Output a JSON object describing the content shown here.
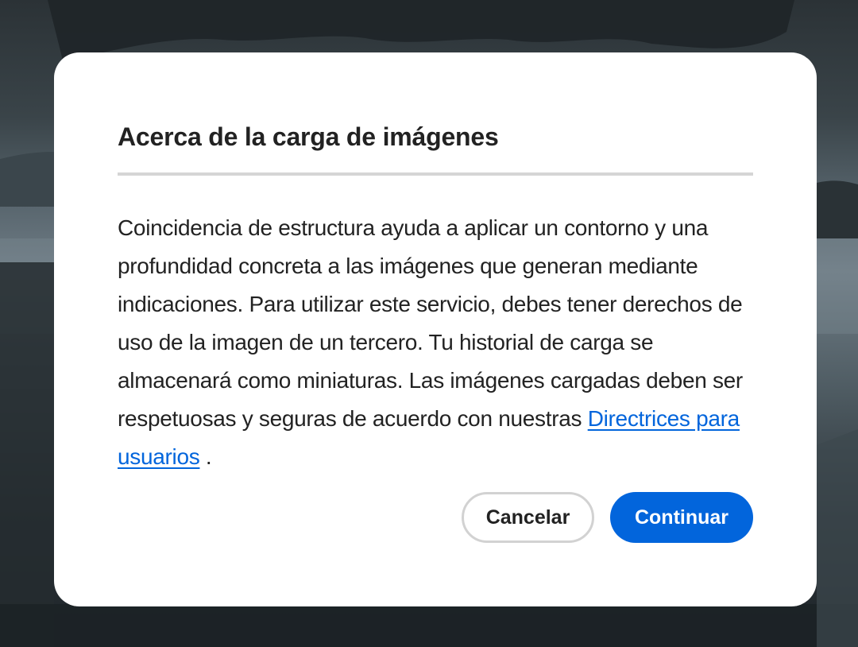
{
  "dialog": {
    "title": "Acerca de la carga de imágenes",
    "body_text": "Coincidencia de estructura ayuda a aplicar un contorno y una profundidad concreta a las imágenes que generan mediante indicaciones. Para utilizar este servicio, debes tener derechos de uso de la imagen de un tercero. Tu historial de carga se almacenará como miniaturas. Las imágenes cargadas deben ser respetuosas y seguras de acuerdo con nuestras ",
    "link_text": "Directrices para usuarios",
    "body_suffix": " .",
    "cancel_label": "Cancelar",
    "continue_label": "Continuar"
  },
  "colors": {
    "accent": "#0265dc",
    "text": "#222222",
    "divider": "#d5d5d5",
    "overlay": "#2b3236"
  }
}
